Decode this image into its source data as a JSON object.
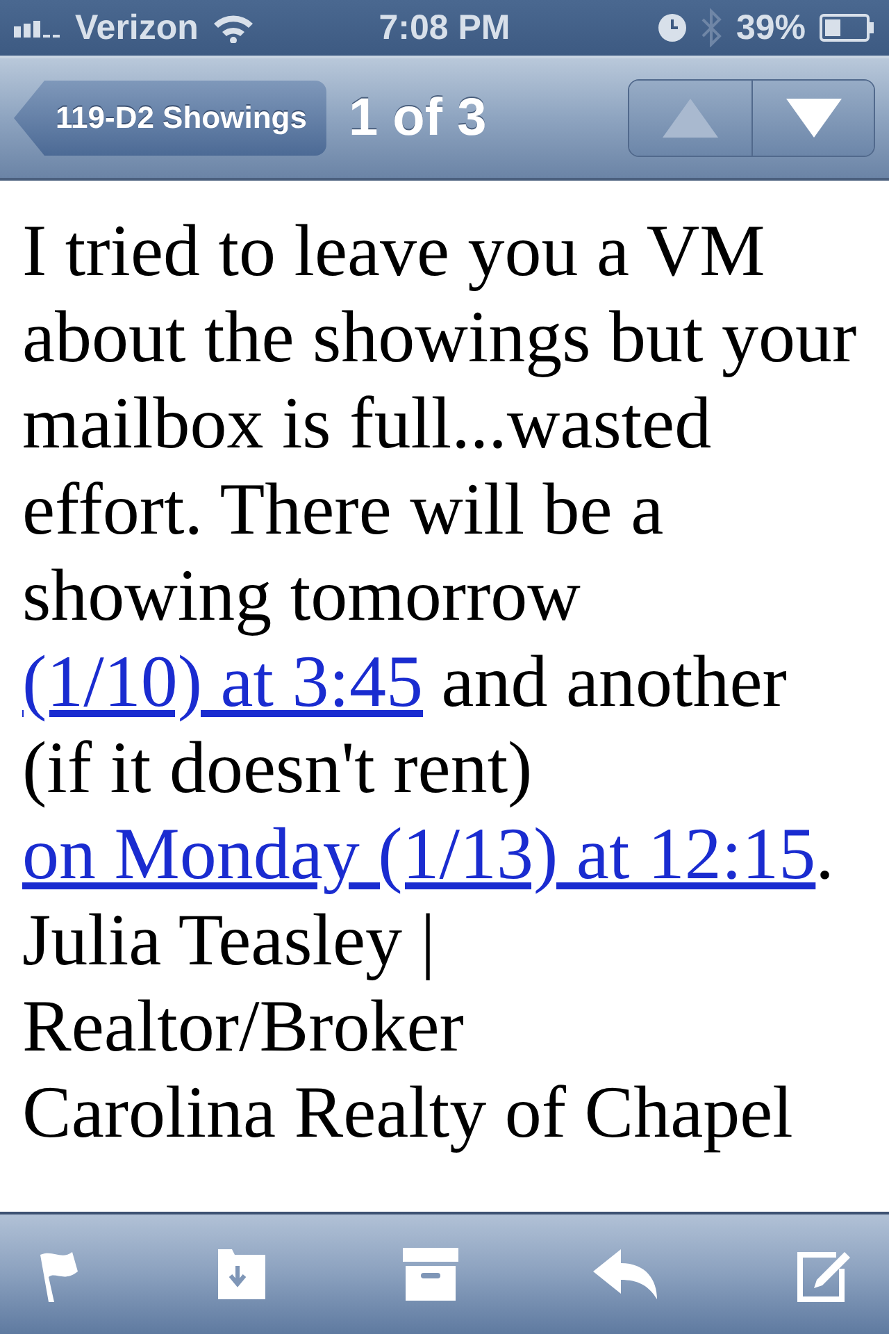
{
  "status_bar": {
    "carrier": "Verizon",
    "time": "7:08 PM",
    "battery": "39%"
  },
  "nav_bar": {
    "back": "119-D2 Showings",
    "position": "1 of 3",
    "arrows": [
      {
        "kind": "up",
        "disabled": true
      },
      {
        "kind": "down",
        "disabled": false
      }
    ]
  },
  "message": {
    "body": [
      {
        "kind": "text",
        "text": "I tried to leave you a VM about the showings but your mailbox is full...wasted effort. There will be a showing tomorrow "
      },
      {
        "kind": "link",
        "text": "(1/10) at 3:45"
      },
      {
        "kind": "text",
        "text": " and another (if it doesn't rent) "
      },
      {
        "kind": "link",
        "text": "on Monday (1/13) at 12:15"
      },
      {
        "kind": "text",
        "text": "."
      }
    ],
    "signature": [
      "Julia Teasley | Realtor/Broker",
      "Carolina Realty of Chapel"
    ]
  },
  "toolbar": [
    {
      "kind": "flag"
    },
    {
      "kind": "move"
    },
    {
      "kind": "archive"
    },
    {
      "kind": "reply"
    },
    {
      "kind": "compose"
    }
  ]
}
